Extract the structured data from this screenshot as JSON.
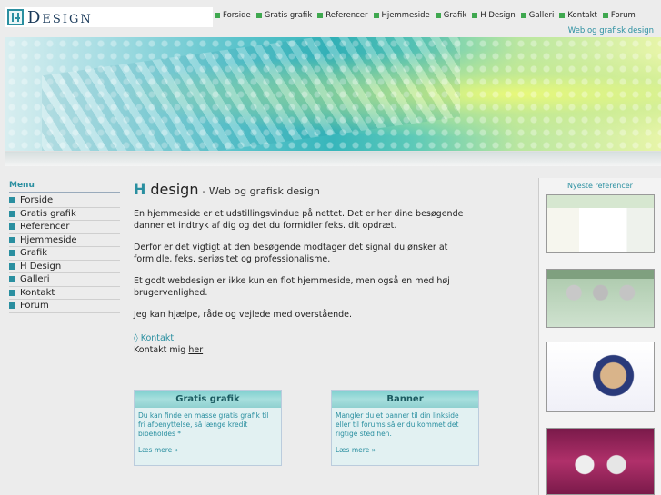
{
  "logo": {
    "text": "Design",
    "mark": "H"
  },
  "topnav": [
    "Forside",
    "Gratis grafik",
    "Referencer",
    "Hjemmeside",
    "Grafik",
    "H Design",
    "Galleri",
    "Kontakt",
    "Forum"
  ],
  "tagline": "Web og grafisk design",
  "sidebar": {
    "title": "Menu",
    "items": [
      "Forside",
      "Gratis grafik",
      "Referencer",
      "Hjemmeside",
      "Grafik",
      "H Design",
      "Galleri",
      "Kontakt",
      "Forum"
    ]
  },
  "main": {
    "heading_h": "H",
    "heading_design": "design",
    "heading_sub": "- Web og grafisk design",
    "paragraphs": [
      "En hjemmeside er et udstillingsvindue på nettet. Det er her dine besøgende danner et indtryk af dig og det du formidler feks. dit opdræt.",
      "Derfor er det vigtigt at den besøgende modtager det signal du ønsker at formidle, feks. seriøsitet og professionalisme.",
      "Et godt webdesign er ikke kun en flot hjemmeside, men også en med høj brugervenlighed.",
      "Jeg kan hjælpe, råde og vejlede med overstående."
    ],
    "contact_link": "◊ Kontakt",
    "contact_text": "Kontakt mig",
    "contact_here": "her"
  },
  "boxes": [
    {
      "title": "Gratis grafik",
      "body": "Du kan finde en masse gratis grafik til fri afbenyttelse, så længe kredit bibeholdes *",
      "more": "Læs mere »"
    },
    {
      "title": "Banner",
      "body": "Mangler du et banner til din linkside eller til forums så er du kommet det rigtige sted hen.",
      "more": "Læs mere »"
    }
  ],
  "references": {
    "title": "Nyeste referencer"
  },
  "colors": {
    "accent": "#2a8fa0",
    "nav_square": "#3fa84f",
    "background": "#ececec"
  }
}
